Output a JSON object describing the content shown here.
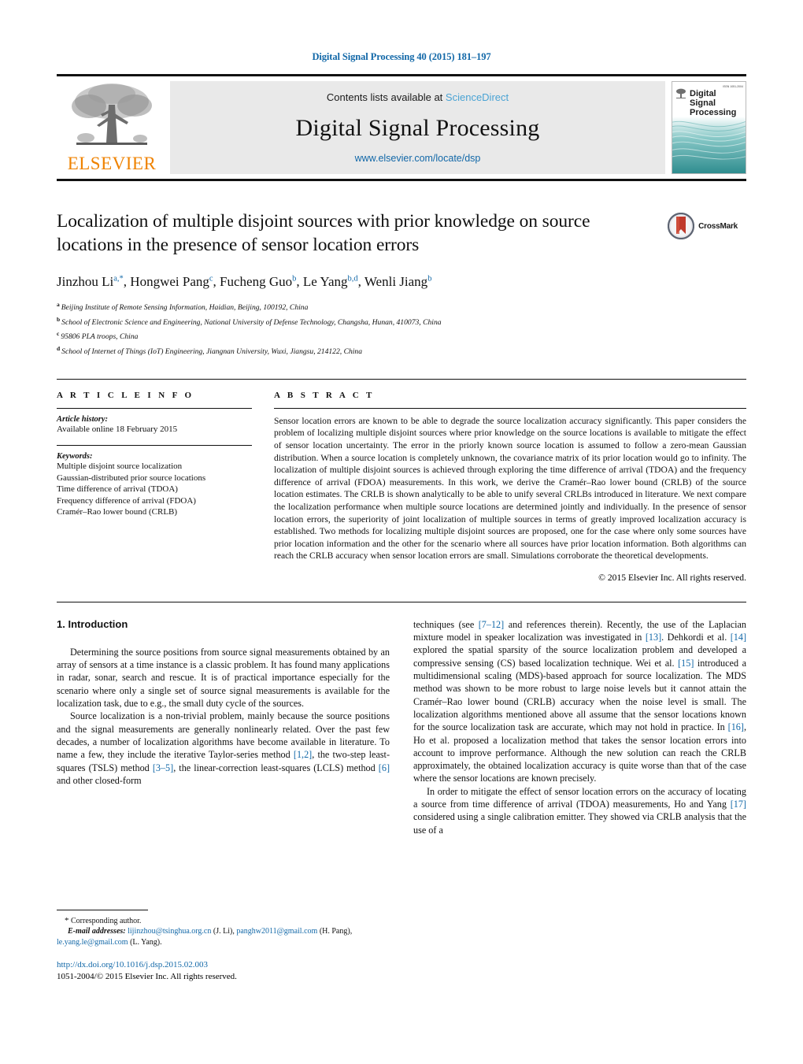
{
  "running_head": "Digital Signal Processing 40 (2015) 181–197",
  "masthead": {
    "publisher_name": "ELSEVIER",
    "contents_prefix": "Contents lists available at",
    "contents_link": "ScienceDirect",
    "journal_title": "Digital Signal Processing",
    "journal_url": "www.elsevier.com/locate/dsp",
    "cover_title_lines": [
      "Digital",
      "Signal",
      "Processing"
    ],
    "cover_code": "ISSN 1051-2004"
  },
  "article": {
    "title": "Localization of multiple disjoint sources with prior knowledge on source locations in the presence of sensor location errors",
    "crossmark_label": "CrossMark",
    "authors_html": "Jinzhou Li<sup>a,*</sup>, Hongwei Pang<sup>c</sup>, Fucheng Guo<sup>b</sup>, Le Yang<sup>b,d</sup>, Wenli Jiang<sup>b</sup>",
    "affiliations": [
      {
        "mark": "a",
        "text": "Beijing Institute of Remote Sensing Information, Haidian, Beijing, 100192, China"
      },
      {
        "mark": "b",
        "text": "School of Electronic Science and Engineering, National University of Defense Technology, Changsha, Hunan, 410073, China"
      },
      {
        "mark": "c",
        "text": "95806 PLA troops, China"
      },
      {
        "mark": "d",
        "text": "School of Internet of Things (IoT) Engineering, Jiangnan University, Wuxi, Jiangsu, 214122, China"
      }
    ]
  },
  "article_info": {
    "heading": "A R T I C L E   I N F O",
    "history_label": "Article history:",
    "history_value": "Available online 18 February 2015",
    "keywords_label": "Keywords:",
    "keywords": [
      "Multiple disjoint source localization",
      "Gaussian-distributed prior source locations",
      "Time difference of arrival (TDOA)",
      "Frequency difference of arrival (FDOA)",
      "Cramér–Rao lower bound (CRLB)"
    ]
  },
  "abstract": {
    "heading": "A B S T R A C T",
    "text": "Sensor location errors are known to be able to degrade the source localization accuracy significantly. This paper considers the problem of localizing multiple disjoint sources where prior knowledge on the source locations is available to mitigate the effect of sensor location uncertainty. The error in the priorly known source location is assumed to follow a zero-mean Gaussian distribution. When a source location is completely unknown, the covariance matrix of its prior location would go to infinity. The localization of multiple disjoint sources is achieved through exploring the time difference of arrival (TDOA) and the frequency difference of arrival (FDOA) measurements. In this work, we derive the Cramér–Rao lower bound (CRLB) of the source location estimates. The CRLB is shown analytically to be able to unify several CRLBs introduced in literature. We next compare the localization performance when multiple source locations are determined jointly and individually. In the presence of sensor location errors, the superiority of joint localization of multiple sources in terms of greatly improved localization accuracy is established. Two methods for localizing multiple disjoint sources are proposed, one for the case where only some sources have prior location information and the other for the scenario where all sources have prior location information. Both algorithms can reach the CRLB accuracy when sensor location errors are small. Simulations corroborate the theoretical developments.",
    "copyright": "© 2015 Elsevier Inc. All rights reserved."
  },
  "body": {
    "section_number_title": "1. Introduction",
    "left_paragraphs": [
      "Determining the source positions from source signal measurements obtained by an array of sensors at a time instance is a classic problem. It has found many applications in radar, sonar, search and rescue. It is of practical importance especially for the scenario where only a single set of source signal measurements is available for the localization task, due to e.g., the small duty cycle of the sources."
    ],
    "left_paragraph_2_parts": [
      "Source localization is a non-trivial problem, mainly because the source positions and the signal measurements are generally nonlinearly related. Over the past few decades, a number of localization algorithms have become available in literature. To name a few, they include the iterative Taylor-series method ",
      "[1,2]",
      ", the two-step least-squares (TSLS) method ",
      "[3–5]",
      ", the linear-correction least-squares (LCLS) method ",
      "[6]",
      " and other closed-form"
    ],
    "right_paragraph_1_parts": [
      "techniques (see ",
      "[7–12]",
      " and references therein). Recently, the use of the Laplacian mixture model in speaker localization was investigated in ",
      "[13]",
      ". Dehkordi et al. ",
      "[14]",
      " explored the spatial sparsity of the source localization problem and developed a compressive sensing (CS) based localization technique. Wei et al. ",
      "[15]",
      " introduced a multidimensional scaling (MDS)-based approach for source localization. The MDS method was shown to be more robust to large noise levels but it cannot attain the Cramér–Rao lower bound (CRLB) accuracy when the noise level is small. The localization algorithms mentioned above all assume that the sensor locations known for the source localization task are accurate, which may not hold in practice. In ",
      "[16]",
      ", Ho et al. proposed a localization method that takes the sensor location errors into account to improve performance. Although the new solution can reach the CRLB approximately, the obtained localization accuracy is quite worse than that of the case where the sensor locations are known precisely."
    ],
    "right_paragraph_2_parts": [
      "In order to mitigate the effect of sensor location errors on the accuracy of locating a source from time difference of arrival (TDOA) measurements, Ho and Yang ",
      "[17]",
      " considered using a single calibration emitter. They showed via CRLB analysis that the use of a"
    ]
  },
  "footnote": {
    "corresponding_mark": "*",
    "corresponding_text": "Corresponding author.",
    "email_label": "E-mail addresses:",
    "emails": [
      {
        "address": "lijinzhou@tsinghua.org.cn",
        "owner": "(J. Li)"
      },
      {
        "address": "panghw2011@gmail.com",
        "owner": "(H. Pang)"
      },
      {
        "address": "le.yang.le@gmail.com",
        "owner": "(L. Yang)"
      }
    ],
    "doi": "http://dx.doi.org/10.1016/j.dsp.2015.02.003",
    "issn_line": "1051-2004/© 2015 Elsevier Inc. All rights reserved."
  },
  "colors": {
    "link_blue": "#1268a8",
    "science_direct_blue": "#4aa3d4",
    "elsevier_orange": "#ef8200",
    "cover_teal": "#2f8d8f",
    "crossmark_red": "#c0392b"
  }
}
